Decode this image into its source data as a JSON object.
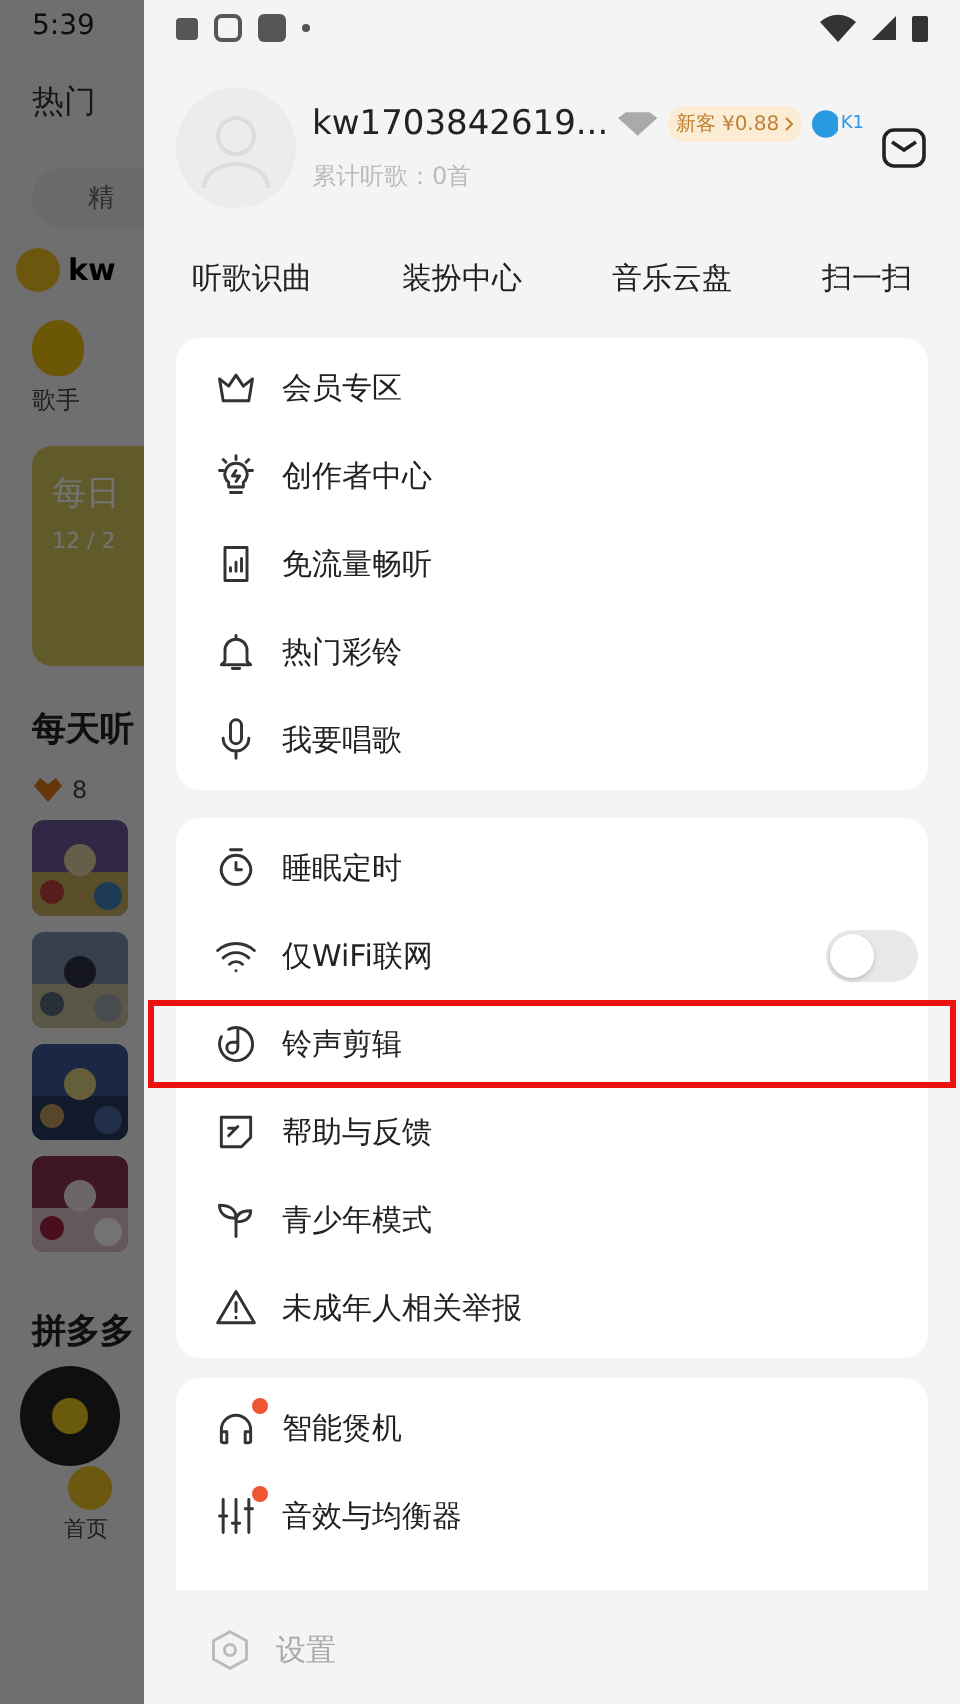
{
  "background": {
    "time": "5:39",
    "tab": "热门",
    "search_text": "精",
    "user": "kw",
    "category": "歌手",
    "card_title": "每日",
    "card_date": "12 / 2",
    "section": "每天听",
    "count": "8",
    "section_2": "拼多多",
    "nav": "首页"
  },
  "profile": {
    "username": "kw1703842619...",
    "stats": "累计听歌：0首",
    "promo": "新客 ¥0.88",
    "level_badge": "K1"
  },
  "shortcuts": [
    "听歌识曲",
    "装扮中心",
    "音乐云盘",
    "扫一扫"
  ],
  "sections": [
    {
      "items": [
        {
          "kind": "link",
          "label": "会员专区",
          "highlighted": false,
          "dot": false
        },
        {
          "kind": "link",
          "label": "创作者中心",
          "highlighted": false,
          "dot": false
        },
        {
          "kind": "link",
          "label": "免流量畅听",
          "highlighted": false,
          "dot": false
        },
        {
          "kind": "link",
          "label": "热门彩铃",
          "highlighted": false,
          "dot": false
        },
        {
          "kind": "link",
          "label": "我要唱歌",
          "highlighted": false,
          "dot": false
        }
      ]
    },
    {
      "items": [
        {
          "kind": "link",
          "label": "睡眠定时",
          "highlighted": false,
          "dot": false
        },
        {
          "kind": "toggle",
          "label": "仅WiFi联网",
          "on": false,
          "highlighted": false,
          "dot": false
        },
        {
          "kind": "link",
          "label": "铃声剪辑",
          "highlighted": true,
          "dot": false
        },
        {
          "kind": "link",
          "label": "帮助与反馈",
          "highlighted": false,
          "dot": false
        },
        {
          "kind": "link",
          "label": "青少年模式",
          "highlighted": false,
          "dot": false
        },
        {
          "kind": "link",
          "label": "未成年人相关举报",
          "highlighted": false,
          "dot": false
        }
      ]
    },
    {
      "items": [
        {
          "kind": "link",
          "label": "智能煲机",
          "highlighted": false,
          "dot": true
        },
        {
          "kind": "link",
          "label": "音效与均衡器",
          "highlighted": false,
          "dot": true
        }
      ]
    }
  ],
  "settings": "设置"
}
